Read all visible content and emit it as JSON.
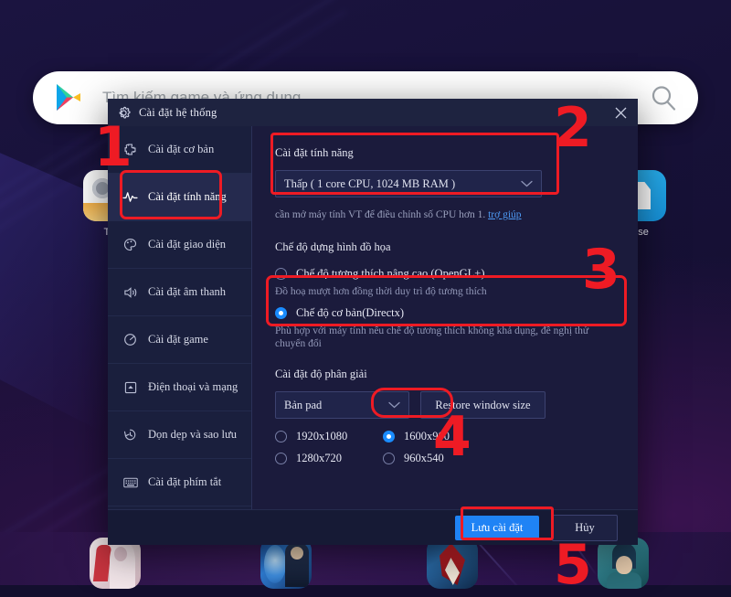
{
  "desktop": {
    "search": {
      "placeholder": "Tìm kiếm game và ứng dụng",
      "play_icon": "google-play-icon",
      "search_icon": "search-icon"
    },
    "apps": [
      {
        "name": "Tc",
        "icon": "camera-app-icon"
      },
      {
        "name": "use",
        "icon": "blue-document-app-icon"
      }
    ],
    "shelf": [
      {
        "icon": "game-icon-1"
      },
      {
        "icon": "game-icon-2"
      },
      {
        "icon": "game-icon-3"
      },
      {
        "icon": "game-icon-4"
      }
    ]
  },
  "dialog": {
    "title": "Cài đặt hệ thống",
    "title_icon": "gear-icon",
    "close_icon": "close-icon",
    "sidebar": [
      {
        "label": "Cài đặt cơ bản",
        "icon": "puzzle-icon",
        "active": false
      },
      {
        "label": "Cài đặt tính năng",
        "icon": "pulse-icon",
        "active": true
      },
      {
        "label": "Cài đặt giao diện",
        "icon": "palette-icon",
        "active": false
      },
      {
        "label": "Cài đặt âm thanh",
        "icon": "sound-icon",
        "active": false
      },
      {
        "label": "Cài đặt game",
        "icon": "gamepad-icon",
        "active": false
      },
      {
        "label": "Điện thoại và mạng",
        "icon": "phone-network-icon",
        "active": false
      },
      {
        "label": "Dọn dẹp và sao lưu",
        "icon": "history-clean-icon",
        "active": false
      },
      {
        "label": "Cài đặt phím tắt",
        "icon": "keyboard-icon",
        "active": false
      }
    ],
    "performance": {
      "heading": "Cài đặt tính năng",
      "dropdown_value": "Thấp ( 1 core CPU, 1024 MB RAM )",
      "dropdown_icon": "chevron-down-icon",
      "hint_text": "cần mở máy tính VT để điều chỉnh số CPU hơn 1.",
      "hint_link": "trợ giúp"
    },
    "graphics": {
      "heading": "Chế độ dựng hình đồ họa",
      "options": [
        {
          "label": "Chế độ tương thích nâng cao (OpenGL+)",
          "desc": "Đồ hoạ mượt hơn đồng thời duy trì độ tương thích",
          "selected": false
        },
        {
          "label": "Chế độ cơ bản(Directx)",
          "desc": "Phù hợp với máy tính nếu chế độ tương thích không khả dụng, đề nghị thử chuyển đổi",
          "selected": true
        }
      ]
    },
    "resolution": {
      "heading": "Cài đặt độ phân giải",
      "dropdown_value": "Bản pad",
      "dropdown_icon": "chevron-down-icon",
      "restore_button": "Restore window size",
      "options": [
        {
          "label": "1920x1080",
          "selected": false
        },
        {
          "label": "1600x900",
          "selected": true
        },
        {
          "label": "1280x720",
          "selected": false
        },
        {
          "label": "960x540",
          "selected": false
        }
      ]
    },
    "footer": {
      "save_label": "Lưu cài đặt",
      "cancel_label": "Hủy"
    }
  },
  "annotations": {
    "markers": [
      {
        "number": "1"
      },
      {
        "number": "2"
      },
      {
        "number": "3"
      },
      {
        "number": "4"
      },
      {
        "number": "5"
      }
    ],
    "color": "#ee1b24"
  }
}
